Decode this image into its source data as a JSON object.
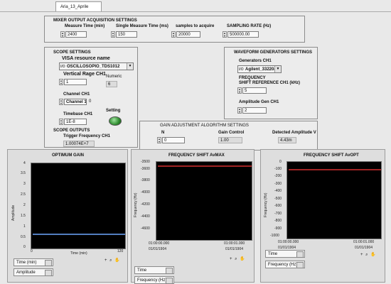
{
  "tab": {
    "label": "Aria_13_Aprile"
  },
  "mixer": {
    "title": "MIXER OUTPUT ACQUISITION SETTINGS",
    "measure_time": {
      "label": "Measure Time (min)",
      "value": "2400"
    },
    "single_measure": {
      "label": "Single Measure Time (ms)",
      "value": "150"
    },
    "samples": {
      "label": "samples to acquire",
      "value": "20000"
    },
    "sampling_rate": {
      "label": "SAMPLING RATE (Hz)",
      "value": "500000.00"
    }
  },
  "scope": {
    "title": "SCOPE SETTINGS",
    "visa_label": "VISA resource name",
    "visa_prefix": "I/O",
    "visa_value": "OSCILLOSOPIO_TDS1012",
    "vertical_label": "Vertical Rage CH1",
    "vertical_value": "1",
    "numeric_label": "Numeric",
    "numeric_value": "6",
    "channel_label": "Channel CH1",
    "channel_value": "Channel 1",
    "channel_index": "0",
    "timebase_label": "Timebase CH1",
    "timebase_value": "1E-8",
    "setting_label": "Setting",
    "outputs_title": "SCOPE OUTPUTS",
    "trigger_label": "Trigger Frequency CH1",
    "trigger_value": "1.00074E+7"
  },
  "waveform": {
    "title": "WAVEFORM GENERATORS SETTINGS",
    "gen_label": "Generators CH1",
    "gen_prefix": "I/O",
    "gen_value": "Agilent_33220a",
    "freq_label_1": "FREQUENCY",
    "freq_label_2": "SHIFT REFERENCE CH1 (kHz)",
    "freq_value": "5",
    "amp_label": "Amplitude Gen CH1",
    "amp_value": "2"
  },
  "gain": {
    "title": "GAIN ADJUSTMENT ALGORITHM SETTINGS",
    "n_label": "N",
    "n_value": "0",
    "control_label": "Gain Control",
    "control_value": "1.00",
    "detected_label": "Detected Amplitude V",
    "detected_value": "4.43m"
  },
  "graphs": {
    "optimum": {
      "title": "OPTIMUM GAIN",
      "yname": "Amplitude",
      "xname": "Time (min)",
      "yticks": [
        "4",
        "3.5",
        "3",
        "2.5",
        "2",
        "1.5",
        "1",
        "0.5",
        "0"
      ],
      "xticks": [
        "0",
        "120"
      ],
      "legend_x": "Time (min)",
      "legend_y": "Amplitude",
      "trace_color": "#6fa8ff"
    },
    "avmax": {
      "title": "FREQUENCY SHIFT AvMAX",
      "yname": "Frequency (Hz)",
      "yticks": [
        "-3500",
        "-3600",
        "-3800",
        "-4000",
        "-4200",
        "-4400",
        "-4600"
      ],
      "xticks_l": [
        "01:00:00.000",
        "01/01/1904"
      ],
      "xticks_r": [
        "01:00:01.000",
        "01/01/1904"
      ],
      "legend_x": "Time",
      "legend_y": "Frequency  (Hz)",
      "trace_color": "#ff3b3b"
    },
    "avopt": {
      "title": "FREQUENCY SHIFT AvOPT",
      "yname": "Frequency (Hz)",
      "yticks": [
        "0",
        "-100",
        "-200",
        "-300",
        "-400",
        "-500",
        "-600",
        "-700",
        "-800",
        "-900",
        "-1000"
      ],
      "xticks_l": [
        "01:00:00.000",
        "01/01/1904"
      ],
      "xticks_r": [
        "01:00:01.000",
        "01/01/1904"
      ],
      "legend_x": "Time",
      "legend_y": "Frequency  (Hz)",
      "trace_color": "#ff3b3b"
    }
  },
  "tool_glyphs": "+ ⌕ ✋"
}
